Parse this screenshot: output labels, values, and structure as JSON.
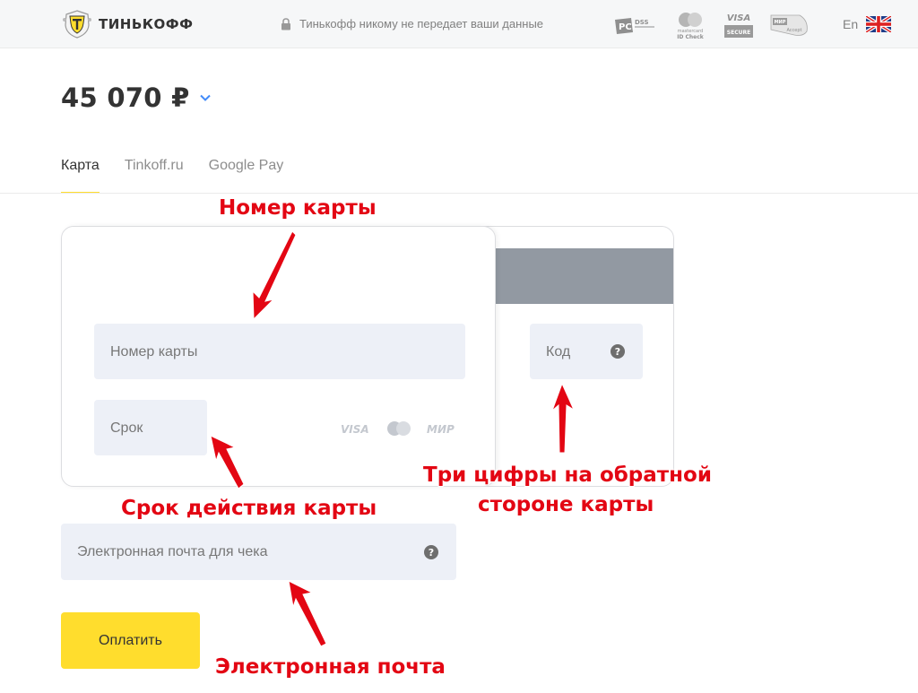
{
  "header": {
    "brand_name": "ТИНЬКОФФ",
    "security_note": "Тинькофф никому не передает ваши данные",
    "payment_badges": {
      "pci_label": "PCI DSS",
      "mastercard_label": "mastercard ID Check",
      "visa_label": "VISA SECURE",
      "mir_label": "МИР Accept"
    },
    "language": "En"
  },
  "amount": {
    "value": "45 070 ₽"
  },
  "tabs": [
    {
      "label": "Карта",
      "active": true
    },
    {
      "label": "Tinkoff.ru",
      "active": false
    },
    {
      "label": "Google Pay",
      "active": false
    }
  ],
  "card_form": {
    "card_number_placeholder": "Номер карты",
    "expiry_placeholder": "Срок",
    "cvc_placeholder": "Код",
    "card_brands": [
      "VISA",
      "mastercard",
      "МИР"
    ]
  },
  "email": {
    "placeholder": "Электронная почта для чека"
  },
  "pay_button": {
    "label": "Оплатить"
  },
  "annotations": {
    "card_number": "Номер карты",
    "expiry": "Срок действия карты",
    "cvc_line1": "Три цифры на обратной",
    "cvc_line2": "стороне карты",
    "email": "Электронная почта"
  },
  "colors": {
    "accent_yellow": "#ffdd2d",
    "field_bg": "#edf0f7",
    "annotation_red": "#e30613",
    "magstripe": "#9299a2"
  }
}
